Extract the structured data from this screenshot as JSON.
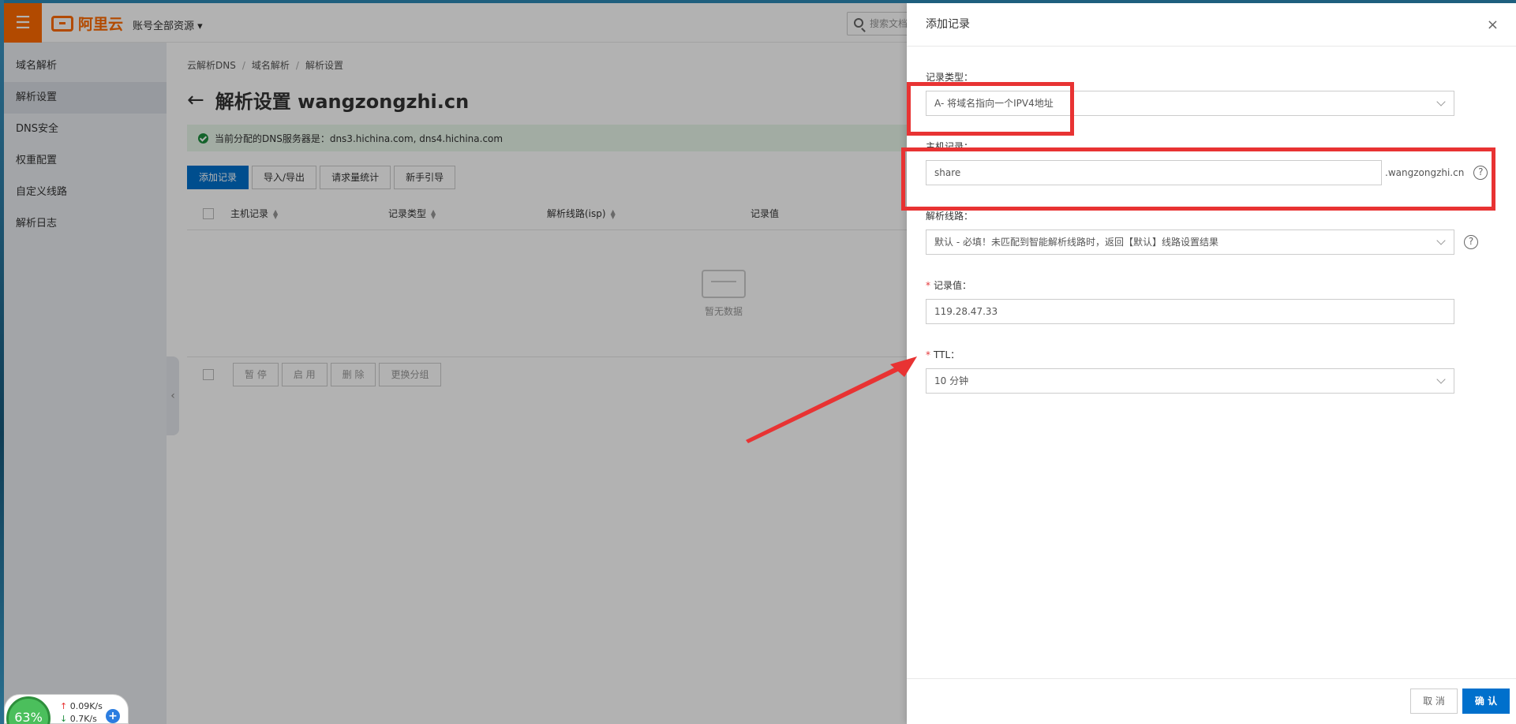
{
  "topbar": {
    "logo_text": "阿里云",
    "account_label": "账号全部资源 ▾",
    "search_placeholder": "搜索文档"
  },
  "sidebar": {
    "title": "域名解析",
    "items": [
      {
        "label": "解析设置",
        "active": true
      },
      {
        "label": "DNS安全"
      },
      {
        "label": "权重配置"
      },
      {
        "label": "自定义线路"
      },
      {
        "label": "解析日志"
      }
    ]
  },
  "main": {
    "breadcrumb": [
      "云解析DNS",
      "域名解析",
      "解析设置"
    ],
    "page_title": "解析设置 wangzongzhi.cn",
    "notice": "当前分配的DNS服务器是：dns3.hichina.com, dns4.hichina.com",
    "toolbar": [
      "添加记录",
      "导入/导出",
      "请求量统计",
      "新手引导"
    ],
    "columns": [
      "主机记录",
      "记录类型",
      "解析线路(isp)",
      "记录值"
    ],
    "empty_text": "暂无数据",
    "bulk_actions": [
      "暂 停",
      "启 用",
      "删 除",
      "更换分组"
    ]
  },
  "drawer": {
    "title": "添加记录",
    "record_type": {
      "label": "记录类型：",
      "value": "A- 将域名指向一个IPV4地址"
    },
    "host": {
      "label": "主机记录：",
      "value": "share",
      "suffix": ".wangzongzhi.cn"
    },
    "line": {
      "label": "解析线路：",
      "value": "默认 - 必填！未匹配到智能解析线路时，返回【默认】线路设置结果"
    },
    "record_value": {
      "label": "记录值：",
      "value": "119.28.47.33"
    },
    "ttl": {
      "label": "TTL：",
      "value": "10 分钟"
    },
    "cancel_label": "取 消",
    "confirm_label": "确 认"
  },
  "netmeter": {
    "percent": "63%",
    "up": "0.09K/s",
    "down": "0.7K/s"
  },
  "colors": {
    "brand_orange": "#ff6a00",
    "primary_blue": "#0070cc",
    "annotation_red": "#e83333"
  }
}
